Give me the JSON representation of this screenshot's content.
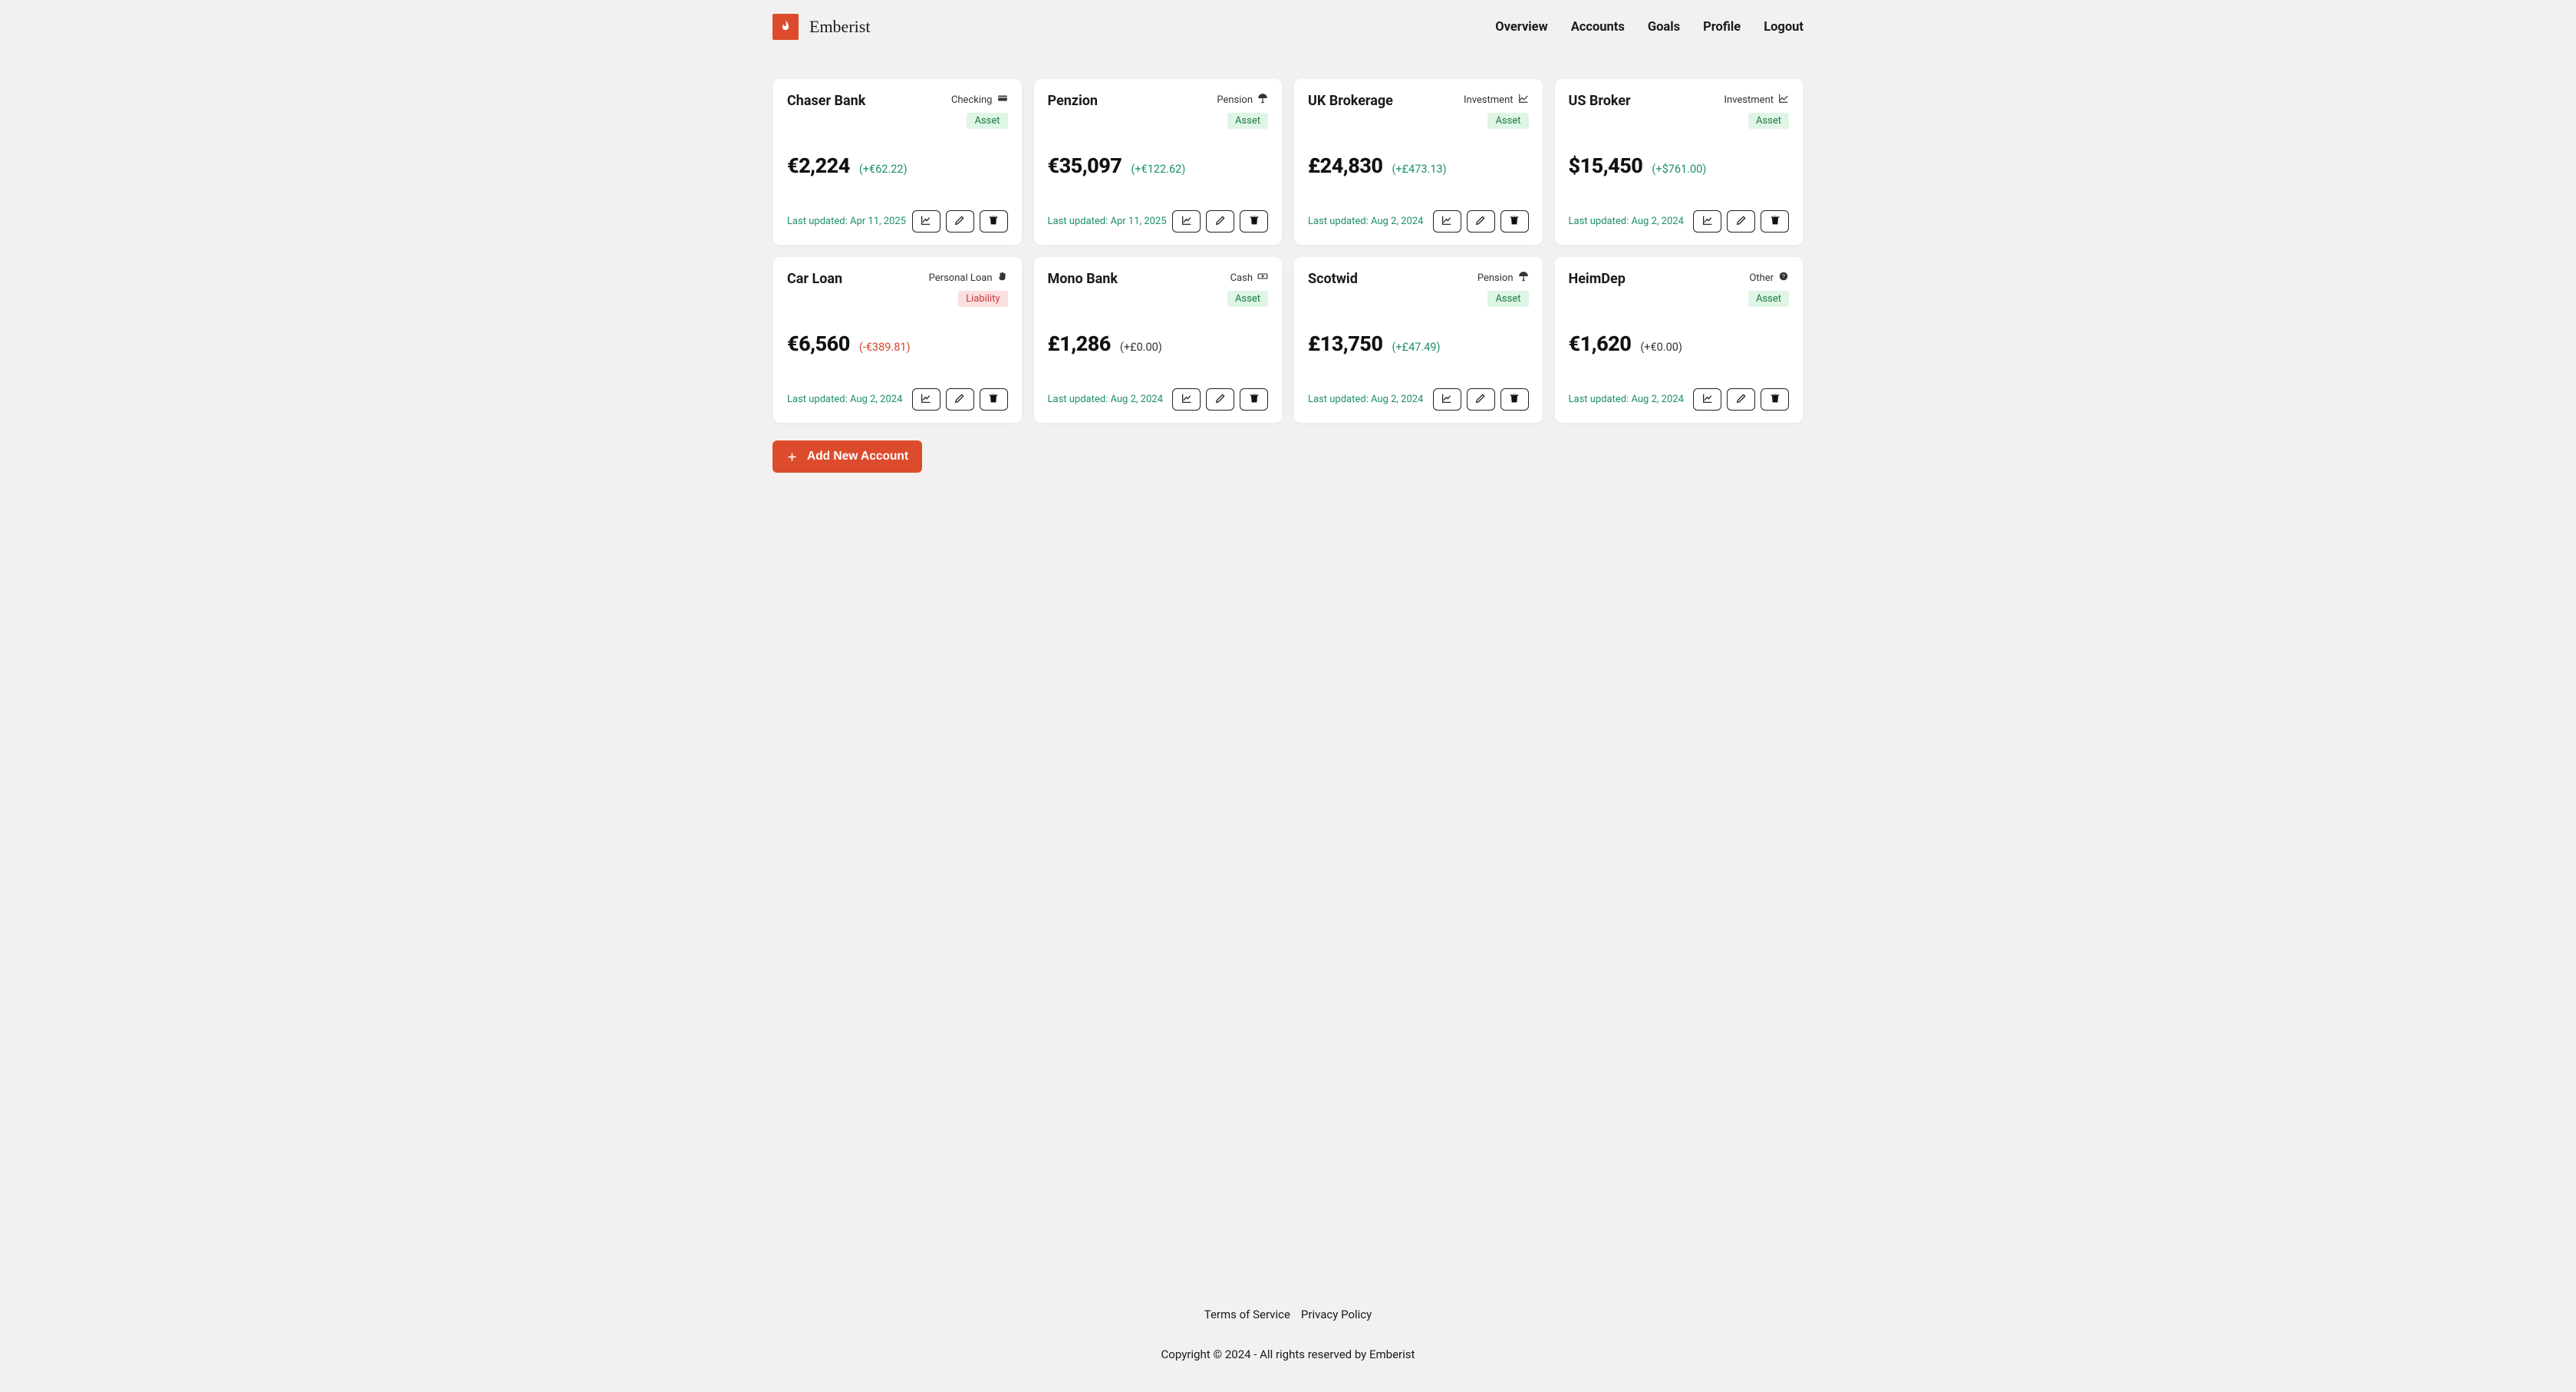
{
  "brand": "Emberist",
  "nav": {
    "overview": "Overview",
    "accounts": "Accounts",
    "goals": "Goals",
    "profile": "Profile",
    "logout": "Logout"
  },
  "add_label": "Add New Account",
  "accounts": [
    {
      "name": "Chaser Bank",
      "type": "Checking",
      "type_icon": "credit-card",
      "badge": "Asset",
      "value": "€2,224",
      "delta": "(+€62.22)",
      "delta_sign": "pos",
      "updated": "Last updated: Apr 11, 2025"
    },
    {
      "name": "Penzion",
      "type": "Pension",
      "type_icon": "umbrella",
      "badge": "Asset",
      "value": "€35,097",
      "delta": "(+€122.62)",
      "delta_sign": "pos",
      "updated": "Last updated: Apr 11, 2025"
    },
    {
      "name": "UK Brokerage",
      "type": "Investment",
      "type_icon": "line-chart",
      "badge": "Asset",
      "value": "£24,830",
      "delta": "(+£473.13)",
      "delta_sign": "pos",
      "updated": "Last updated: Aug 2, 2024"
    },
    {
      "name": "US Broker",
      "type": "Investment",
      "type_icon": "line-chart",
      "badge": "Asset",
      "value": "$15,450",
      "delta": "(+$761.00)",
      "delta_sign": "pos",
      "updated": "Last updated: Aug 2, 2024"
    },
    {
      "name": "Car Loan",
      "type": "Personal Loan",
      "type_icon": "hand",
      "badge": "Liability",
      "value": "€6,560",
      "delta": "(-€389.81)",
      "delta_sign": "neg",
      "updated": "Last updated: Aug 2, 2024"
    },
    {
      "name": "Mono Bank",
      "type": "Cash",
      "type_icon": "money",
      "badge": "Asset",
      "value": "£1,286",
      "delta": "(+£0.00)",
      "delta_sign": "zero",
      "updated": "Last updated: Aug 2, 2024"
    },
    {
      "name": "Scotwid",
      "type": "Pension",
      "type_icon": "umbrella",
      "badge": "Asset",
      "value": "£13,750",
      "delta": "(+£47.49)",
      "delta_sign": "pos",
      "updated": "Last updated: Aug 2, 2024"
    },
    {
      "name": "HeimDep",
      "type": "Other",
      "type_icon": "question",
      "badge": "Asset",
      "value": "€1,620",
      "delta": "(+€0.00)",
      "delta_sign": "zero",
      "updated": "Last updated: Aug 2, 2024"
    }
  ],
  "footer": {
    "terms": "Terms of Service",
    "privacy": "Privacy Policy",
    "copyright": "Copyright © 2024 - All rights reserved by Emberist"
  }
}
